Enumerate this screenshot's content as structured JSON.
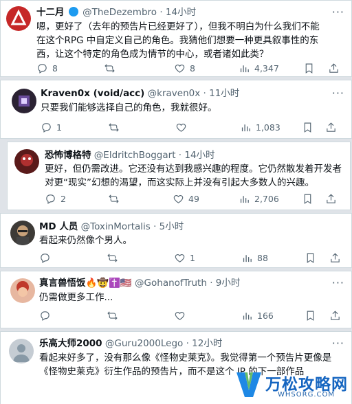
{
  "tweets": [
    {
      "name": "十二月",
      "handle": "@TheDezembro",
      "time": "· 14小时",
      "text": "嗯，更好了（去年的预告片已经更好了），但我不明白为什么我们不能在这个RPG 中自定义自己的角色。我猜他们想要一种更具叙事性的东西，让这个特定的角色成为情节的中心，或者诸如此类？",
      "replies": "8",
      "retweets": "",
      "likes": "8",
      "views": "4,347"
    },
    {
      "name": "Kraven0x (void/acc)",
      "handle": "@kraven0x",
      "time": "· 11小时",
      "text": "只要我们能够选择自己的角色，我就很好。",
      "replies": "1",
      "retweets": "",
      "likes": "",
      "views": "1,083"
    },
    {
      "name": "恐怖博格特",
      "handle": "@EldritchBoggart",
      "time": "· 14小时",
      "text": "更好，但仍需改进。它还没有达到我感兴趣的程度。它仍然散发着开发者对更“现实”幻想的渴望，而这实际上并没有引起大多数人的兴趣。",
      "replies": "2",
      "retweets": "",
      "likes": "49",
      "views": "2,706"
    },
    {
      "name": "MD 人员",
      "handle": "@ToxinMortalis",
      "time": "· 5小时",
      "text": "看起来仍然像个男人。",
      "replies": "",
      "retweets": "",
      "likes": "1",
      "views": "88"
    },
    {
      "name": "真言兽悟饭🔥🤠✝️🇺🇸",
      "handle": "@GohanofTruth",
      "time": "· 9小时",
      "text": "仍需做更多工作...",
      "replies": "",
      "retweets": "",
      "likes": "",
      "views": "166"
    },
    {
      "name": "乐高大师2000",
      "handle": "@Guru2000Lego",
      "time": "· 12小时",
      "text": "看起来好多了，没有那么像《怪物史莱克》。我觉得第一个预告片更像是《怪物史莱克》衍生作品的预告片，而不是这个 IP 的下一部作品",
      "replies": "",
      "retweets": "",
      "likes": "",
      "views": ""
    }
  ],
  "more_label": "···",
  "watermark": {
    "text": "万松攻略网",
    "subtext": "WHSORG.COM"
  },
  "colors": {
    "text": "#0f1419",
    "muted": "#536471",
    "border": "#cfd9de",
    "watermark": "#1565c0"
  },
  "icons": [
    "reply-icon",
    "retweet-icon",
    "like-icon",
    "views-icon",
    "bookmark-icon",
    "share-icon",
    "more-icon"
  ]
}
